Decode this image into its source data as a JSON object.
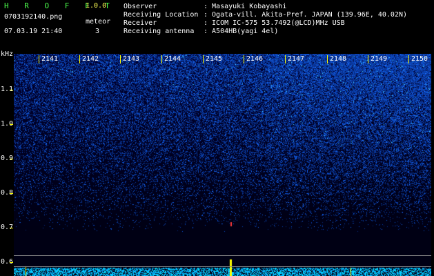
{
  "app": {
    "title": "H R O F F T",
    "version": "1.0.0"
  },
  "capture": {
    "filename": "0703192140.png",
    "datetime": "07.03.19 21:40",
    "meteor_label": "meteor",
    "meteor_count": "3"
  },
  "info": [
    {
      "label": "Observer",
      "value": ": Masayuki Kobayashi"
    },
    {
      "label": "Receiving Location",
      "value": ": Ogata-vill. Akita-Pref. JAPAN (139.96E, 40.02N)"
    },
    {
      "label": "Receiver",
      "value": ": ICOM IC-575 53.7492(@LCD)MHz USB"
    },
    {
      "label": "Receiving antenna",
      "value": ": A504HB(yagi 4el)"
    }
  ],
  "axis": {
    "y_unit": "kHz",
    "y_ticks": [
      "1.1",
      "1.0",
      "0.9",
      "0.8",
      "0.7",
      "0.6"
    ],
    "x_ticks": [
      "2141",
      "2142",
      "2143",
      "2144",
      "2145",
      "2146",
      "2147",
      "2148",
      "2149",
      "2150"
    ]
  },
  "colors": {
    "title": "#4cff4c",
    "version": "#ffff55",
    "tick": "#ffff00",
    "noise": "#1e3cff"
  }
}
